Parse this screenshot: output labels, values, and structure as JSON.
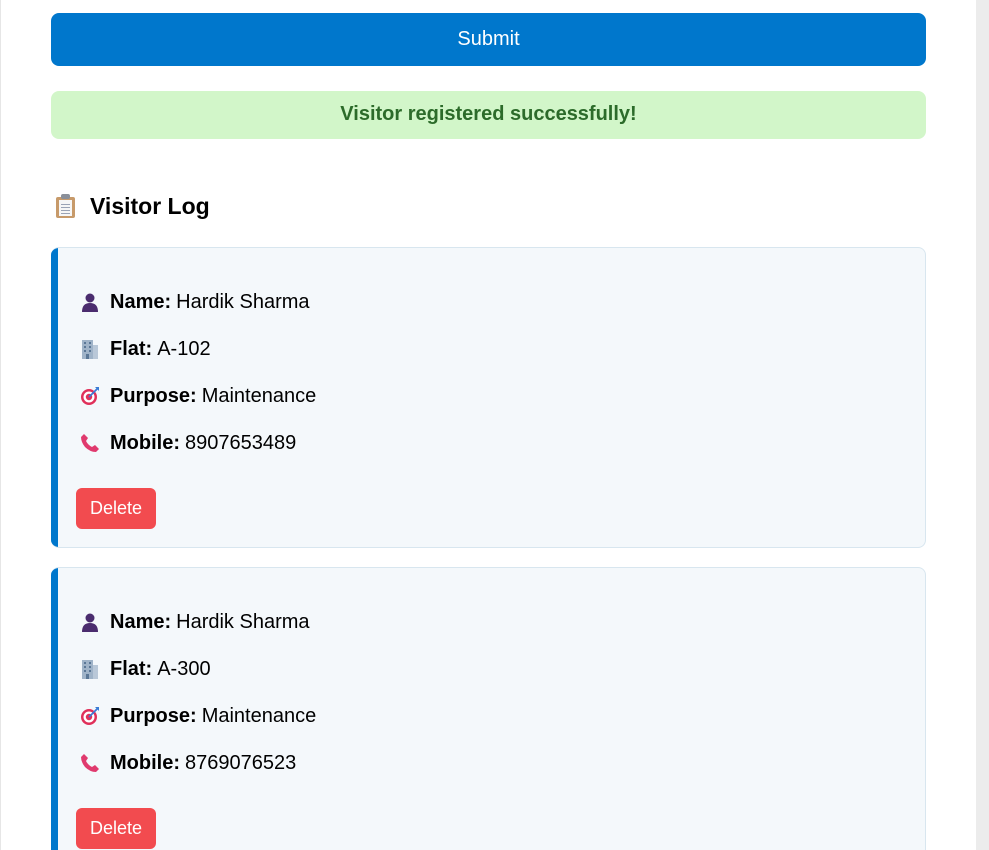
{
  "form": {
    "submit_label": "Submit"
  },
  "alert": {
    "message": "Visitor registered successfully!"
  },
  "log": {
    "title": "Visitor Log",
    "icon": "clipboard-icon",
    "field_labels": {
      "name": "Name:",
      "flat": "Flat:",
      "purpose": "Purpose:",
      "mobile": "Mobile:"
    },
    "field_icons": {
      "name": "person-icon",
      "flat": "building-icon",
      "purpose": "target-icon",
      "mobile": "phone-icon"
    },
    "delete_label": "Delete",
    "entries": [
      {
        "name": "Hardik Sharma",
        "flat": "A-102",
        "purpose": "Maintenance",
        "mobile": "8907653489"
      },
      {
        "name": "Hardik Sharma",
        "flat": "A-300",
        "purpose": "Maintenance",
        "mobile": "8769076523"
      }
    ]
  },
  "colors": {
    "primary": "#0077cc",
    "success_bg": "#d2f6c9",
    "success_text": "#2c6b2a",
    "danger": "#f24b4f",
    "card_bg": "#f4f8fb"
  }
}
